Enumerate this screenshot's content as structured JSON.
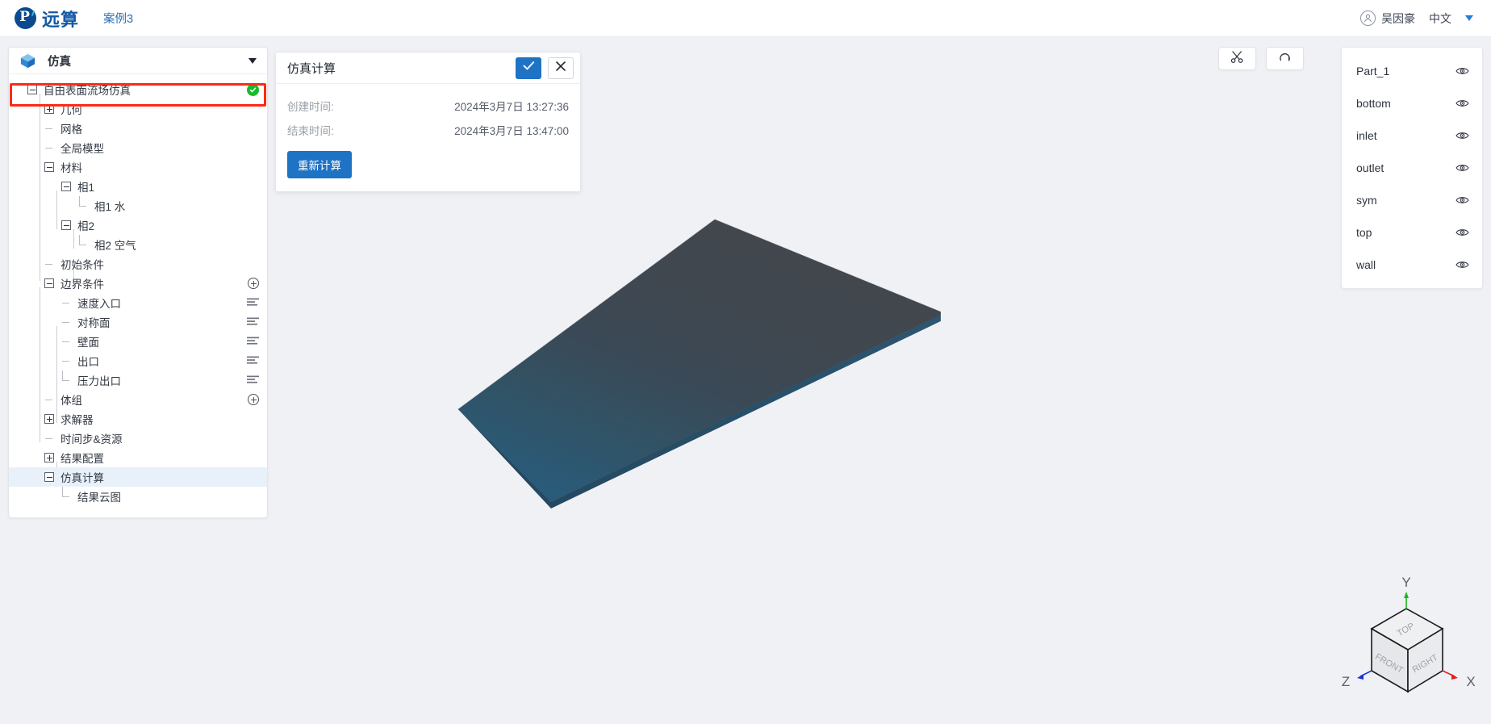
{
  "header": {
    "brand": "远算",
    "case_name": "案例3",
    "user_name": "吴因豪",
    "language": "中文",
    "avatar_icon": "user-circle-icon",
    "caret_icon": "chevron-down-icon"
  },
  "sidebar": {
    "panel_title": "仿真",
    "panel_icon": "cube-icon",
    "collapse_icon": "chevron-down-icon",
    "tree": [
      {
        "label": "自由表面流场仿真",
        "toggle": "minus",
        "depth": 0,
        "status": "ok",
        "highlighted": true
      },
      {
        "label": "几何",
        "toggle": "plus",
        "depth": 1
      },
      {
        "label": "网格",
        "toggle": "none",
        "depth": 1
      },
      {
        "label": "全局模型",
        "toggle": "none",
        "depth": 1
      },
      {
        "label": "材料",
        "toggle": "minus",
        "depth": 1
      },
      {
        "label": "相1",
        "toggle": "minus",
        "depth": 2
      },
      {
        "label": "相1 水",
        "toggle": "none",
        "depth": 3
      },
      {
        "label": "相2",
        "toggle": "minus",
        "depth": 2
      },
      {
        "label": "相2 空气",
        "toggle": "none",
        "depth": 3
      },
      {
        "label": "初始条件",
        "toggle": "none",
        "depth": 1
      },
      {
        "label": "边界条件",
        "toggle": "minus",
        "depth": 1,
        "action": "add"
      },
      {
        "label": "速度入口",
        "toggle": "none",
        "depth": 2,
        "action": "list"
      },
      {
        "label": "对称面",
        "toggle": "none",
        "depth": 2,
        "action": "list"
      },
      {
        "label": "壁面",
        "toggle": "none",
        "depth": 2,
        "action": "list"
      },
      {
        "label": "出口",
        "toggle": "none",
        "depth": 2,
        "action": "list"
      },
      {
        "label": "压力出口",
        "toggle": "none",
        "depth": 2,
        "action": "list"
      },
      {
        "label": "体组",
        "toggle": "none",
        "depth": 1,
        "action": "add"
      },
      {
        "label": "求解器",
        "toggle": "plus",
        "depth": 1
      },
      {
        "label": "时间步&资源",
        "toggle": "none",
        "depth": 1
      },
      {
        "label": "结果配置",
        "toggle": "plus",
        "depth": 1
      },
      {
        "label": "仿真计算",
        "toggle": "minus",
        "depth": 1,
        "selected": true
      },
      {
        "label": "结果云图",
        "toggle": "none",
        "depth": 2
      }
    ],
    "highlight_color": "#fc2b15",
    "status_ok_color": "#18ba26"
  },
  "dialog": {
    "title": "仿真计算",
    "confirm_icon": "check-icon",
    "close_icon": "close-icon",
    "fields": [
      {
        "label": "创建时间:",
        "value": "2024年3月7日 13:27:36"
      },
      {
        "label": "结束时间:",
        "value": "2024年3月7日 13:47:00"
      }
    ],
    "recalc_label": "重新计算",
    "accent_color": "#1f73c4"
  },
  "viewport": {
    "toolbar": [
      {
        "icon": "scissors-icon",
        "name": "clip-tool"
      },
      {
        "icon": "reset-rotate-icon",
        "name": "reset-view-tool"
      }
    ],
    "model_color_top": "#474a50",
    "model_color_bottom": "#2b5d7e",
    "background": "#f0f1f5"
  },
  "parts_panel": {
    "items": [
      {
        "name": "Part_1",
        "visible_icon": "eye-icon"
      },
      {
        "name": "bottom",
        "visible_icon": "eye-icon"
      },
      {
        "name": "inlet",
        "visible_icon": "eye-icon"
      },
      {
        "name": "outlet",
        "visible_icon": "eye-icon"
      },
      {
        "name": "sym",
        "visible_icon": "eye-icon"
      },
      {
        "name": "top",
        "visible_icon": "eye-icon"
      },
      {
        "name": "wall",
        "visible_icon": "eye-icon"
      }
    ]
  },
  "orientation_cube": {
    "axis_labels": {
      "x": "X",
      "y": "Y",
      "z": "Z"
    },
    "faces": {
      "top": "TOP",
      "front": "FRONT",
      "right": "RIGHT"
    },
    "axis_colors": {
      "x": "#e02020",
      "y": "#1db81d",
      "z": "#1a36d8"
    }
  }
}
